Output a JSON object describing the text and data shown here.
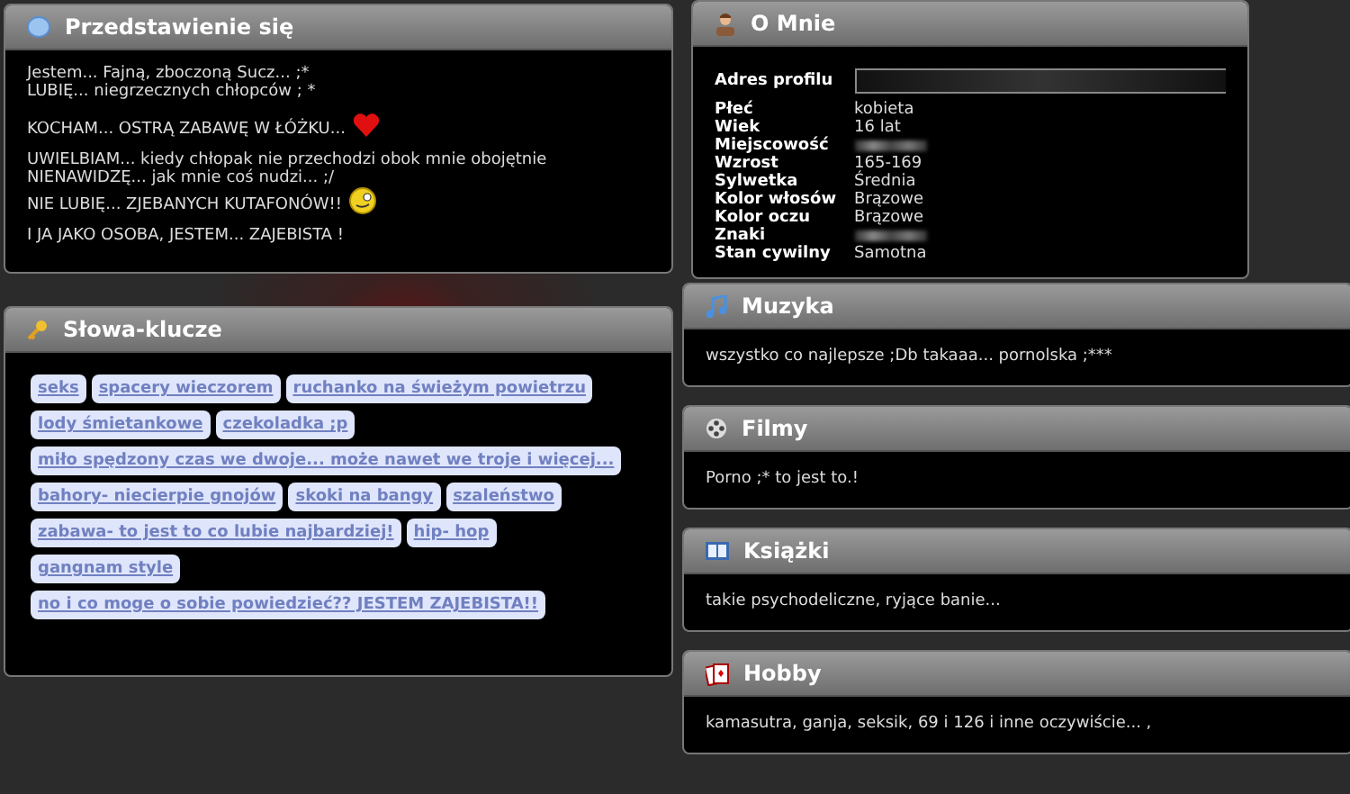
{
  "introduction": {
    "title": "Przedstawienie się",
    "paragraphs": [
      [
        "Jestem... Fajną, zboczoną Sucz... ;*",
        "LUBIĘ... niegrzecznych chłopców ; *"
      ],
      [
        "KOCHAM... OSTRĄ ZABAWĘ W ŁÓŻKU..."
      ],
      [
        "UWIELBIAM... kiedy chłopak nie przechodzi obok mnie obojętnie",
        "NIENAWIDZĘ... jak mnie coś nudzi... ;/",
        "NIE LUBIĘ... ZJEBANYCH KUTAFONÓW!!"
      ],
      [
        "I JA JAKO OSOBA, JESTEM... ZAJEBISTA !"
      ]
    ]
  },
  "keywords": {
    "title": "Słowa-klucze",
    "tags": [
      "seks",
      "spacery wieczorem",
      "ruchanko na świeżym powietrzu",
      "lody śmietankowe",
      "czekoladka ;p",
      "miło spędzony czas we dwoje... może nawet we troje i więcej...",
      "bahory- niecierpie gnojów",
      "skoki na bangy",
      "szaleństwo",
      "zabawa- to jest to co lubie najbardziej!",
      "hip- hop",
      "gangnam style",
      "no i co moge o sobie powiedzieć?? JESTEM ZAJEBISTA!!"
    ]
  },
  "about": {
    "title": "O Mnie",
    "fields": [
      {
        "label": "Adres profilu",
        "kind": "link"
      },
      {
        "label": "Płeć",
        "value": "kobieta",
        "kind": "text"
      },
      {
        "label": "Wiek",
        "value": "16 lat",
        "kind": "text"
      },
      {
        "label": "Miejscowość",
        "kind": "blurred"
      },
      {
        "label": "Wzrost",
        "value": "165-169",
        "kind": "text"
      },
      {
        "label": "Sylwetka",
        "value": "Średnia",
        "kind": "text"
      },
      {
        "label": "Kolor włosów",
        "value": "Brązowe",
        "kind": "text"
      },
      {
        "label": "Kolor oczu",
        "value": "Brązowe",
        "kind": "text"
      },
      {
        "label": "Znaki",
        "kind": "blurred"
      },
      {
        "label": "Stan cywilny",
        "value": "Samotna",
        "kind": "text"
      }
    ]
  },
  "music": {
    "title": "Muzyka",
    "text": "wszystko co najlepsze ;Db takaaa... pornolska ;***"
  },
  "films": {
    "title": "Filmy",
    "text": "Porno ;* to jest to.!"
  },
  "books": {
    "title": "Książki",
    "text": "takie psychodeliczne, ryjące banie..."
  },
  "hobby": {
    "title": "Hobby",
    "text": "kamasutra, ganja, seksik, 69 i 126 i inne oczywiście... ,"
  }
}
